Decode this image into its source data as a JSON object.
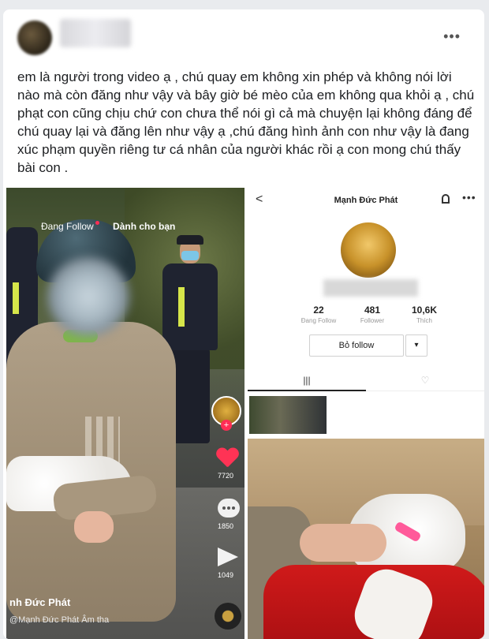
{
  "post": {
    "more_label": "•••",
    "text": "em là người trong video ạ , chú quay em không xin phép và không nói lời nào mà còn đăng như vậy và bây giờ bé mèo của em không qua khỏi ạ , chú phạt con cũng chịu chứ con chưa thể nói gì cả mà chuyện lại không đáng để chú quay lại và đăng lên như vậy ạ ,chú đăng hình ảnh con như vậy là đang xúc phạm quyền riêng tư cá nhân của người khác rồi ạ con mong chú thấy bài con ."
  },
  "tiktok_video": {
    "tab_following": "Đang Follow",
    "tab_for_you": "Dành cho bạn",
    "likes": "7720",
    "comments": "1850",
    "shares": "1049",
    "username": "nh Đức Phát",
    "music": "@Mạnh Đức Phát Âm tha",
    "plus": "+"
  },
  "tiktok_profile": {
    "back": "<",
    "name": "Mạnh Đức Phát",
    "more": "•••",
    "stats": [
      {
        "num": "22",
        "label": "Đang Follow"
      },
      {
        "num": "481",
        "label": "Follower"
      },
      {
        "num": "10,6K",
        "label": "Thích"
      }
    ],
    "follow_button": "Bỏ follow",
    "dropdown": "▾",
    "tab_grid": "|||",
    "tab_liked": "♡"
  },
  "colors": {
    "like_red": "#ff3355",
    "tiktok_pink": "#ff2d55",
    "card_bg": "#ffffff",
    "page_bg": "#e9ebee"
  }
}
